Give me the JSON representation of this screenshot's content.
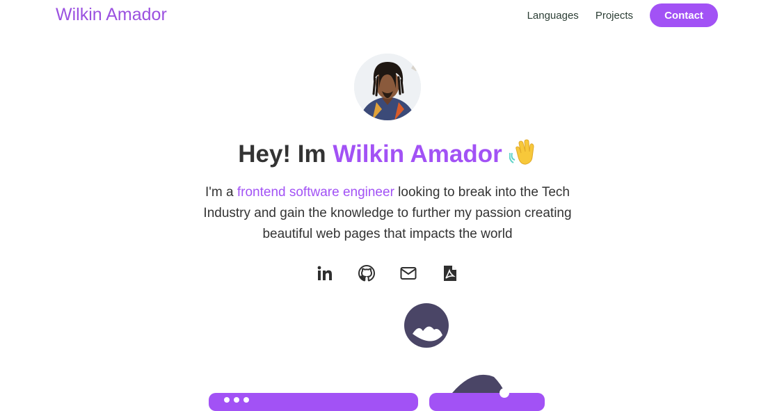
{
  "nav": {
    "brand": "Wilkin Amador",
    "links": [
      {
        "label": "Languages"
      },
      {
        "label": "Projects"
      }
    ],
    "contact_label": "Contact"
  },
  "hero": {
    "title_prefix": "Hey! Im ",
    "title_name": "Wilkin Amador",
    "wave_icon": "waving-hand-icon",
    "desc_prefix": "I'm a ",
    "desc_highlight": "frontend software engineer",
    "desc_rest": " looking to break into the Tech Industry and gain the knowledge to further my passion creating beautiful web pages that impacts the world"
  },
  "socials": [
    {
      "icon": "linkedin-icon"
    },
    {
      "icon": "github-icon"
    },
    {
      "icon": "mail-icon"
    },
    {
      "icon": "pdf-file-icon"
    }
  ],
  "colors": {
    "accent": "#a252f5",
    "text": "#333333",
    "illustration_dark": "#4a4566"
  }
}
